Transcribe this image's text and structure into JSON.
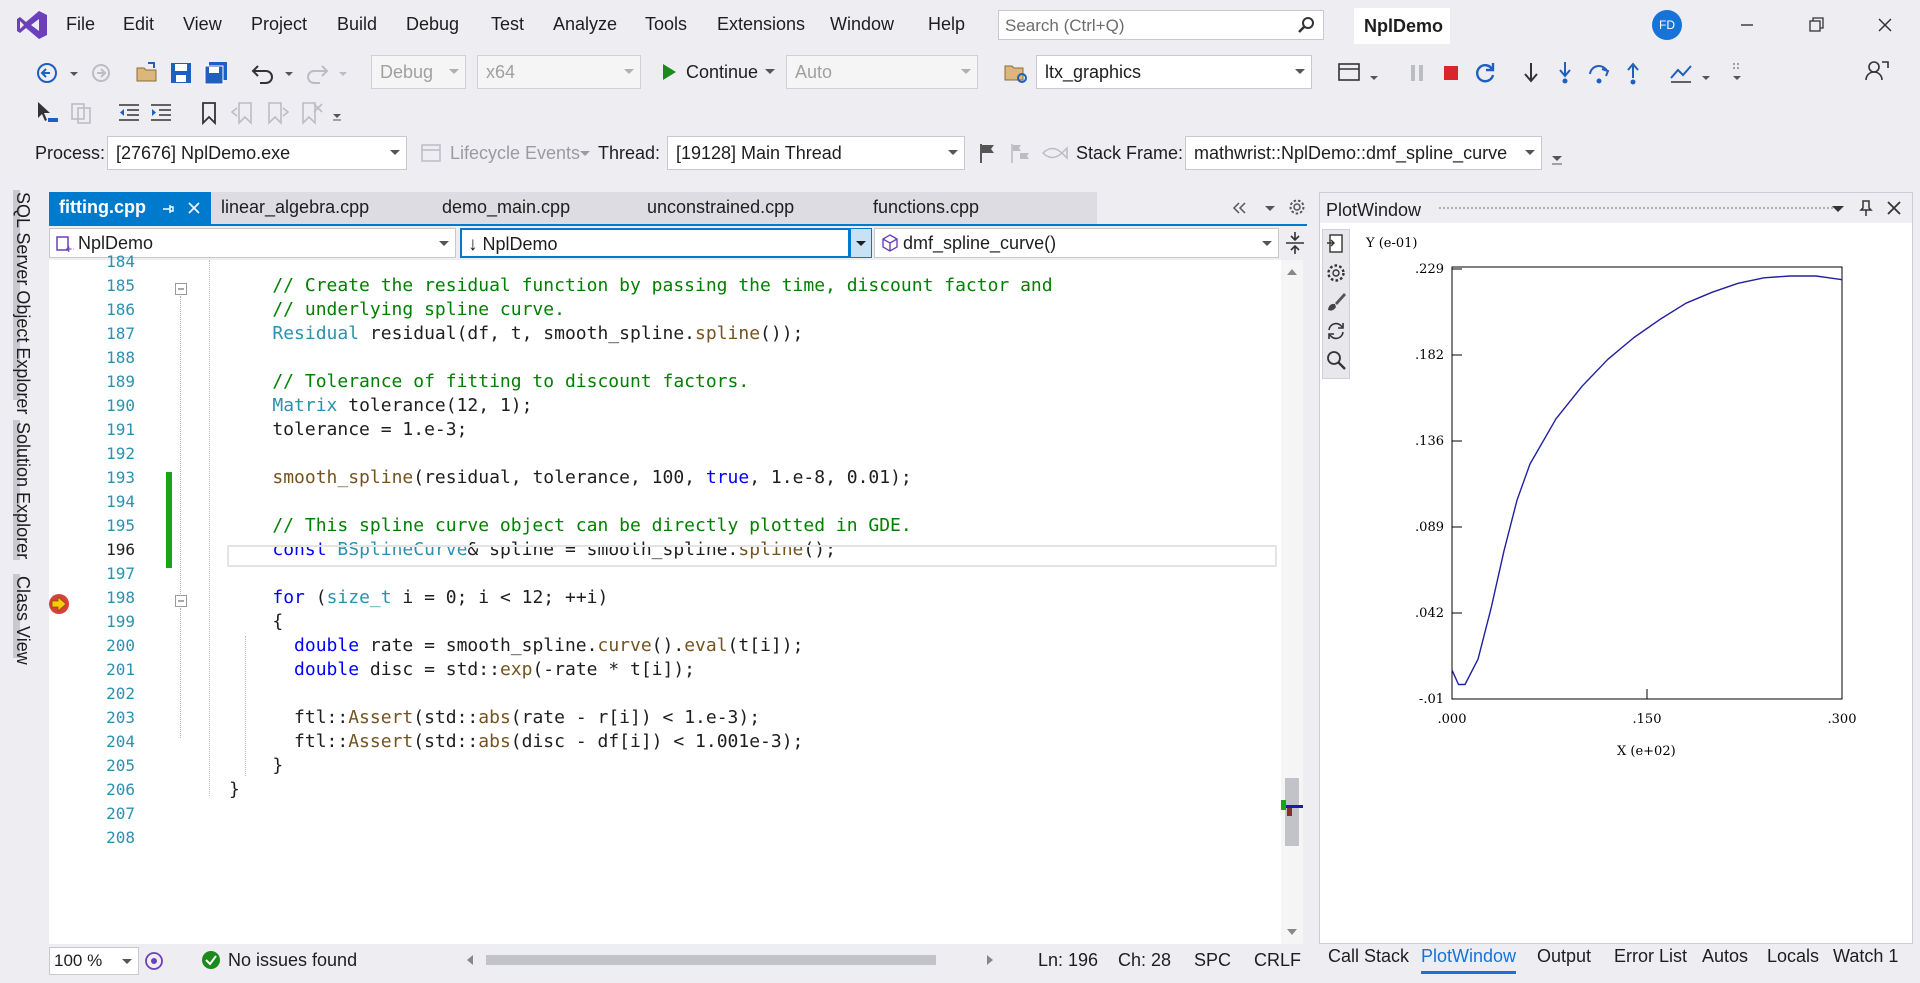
{
  "menu": [
    "File",
    "Edit",
    "View",
    "Project",
    "Build",
    "Debug",
    "Test",
    "Analyze",
    "Tools",
    "Extensions",
    "Window",
    "Help"
  ],
  "search": {
    "placeholder": "Search (Ctrl+Q)"
  },
  "solution_title": "NplDemo",
  "user_initials": "FD",
  "toolbar1": {
    "config": "Debug",
    "platform": "x64",
    "continue_label": "Continue",
    "auto": "Auto",
    "project": "ltx_graphics"
  },
  "debug_location": {
    "process_label": "Process:",
    "process": "[27676] NplDemo.exe",
    "lifecycle_label": "Lifecycle Events",
    "thread_label": "Thread:",
    "thread": "[19128] Main Thread",
    "stack_label": "Stack Frame:",
    "stack_frame": "mathwrist::NplDemo::dmf_spline_curve"
  },
  "side_tabs": [
    "SQL Server Object Explorer",
    "Solution Explorer",
    "Class View"
  ],
  "doc_tabs": [
    "fitting.cpp",
    "linear_algebra.cpp",
    "demo_main.cpp",
    "unconstrained.cpp",
    "functions.cpp"
  ],
  "nav": {
    "project": "NplDemo",
    "scope": "NplDemo",
    "member": "dmf_spline_curve()"
  },
  "editor": {
    "current_line": "196",
    "lines": [
      {
        "n": "184",
        "segs": []
      },
      {
        "n": "185",
        "segs": [
          {
            "t": "    // Create the residual function by passing the time, discount factor and",
            "c": "cm"
          }
        ]
      },
      {
        "n": "186",
        "segs": [
          {
            "t": "    // underlying spline curve.",
            "c": "cm"
          }
        ]
      },
      {
        "n": "187",
        "segs": [
          {
            "t": "    ",
            "c": "tx"
          },
          {
            "t": "Residual",
            "c": "ty"
          },
          {
            "t": " residual(df, t, smooth_spline.",
            "c": "tx"
          },
          {
            "t": "spline",
            "c": "fn"
          },
          {
            "t": "());",
            "c": "tx"
          }
        ]
      },
      {
        "n": "188",
        "segs": []
      },
      {
        "n": "189",
        "segs": [
          {
            "t": "    // Tolerance of fitting to discount factors.",
            "c": "cm"
          }
        ]
      },
      {
        "n": "190",
        "segs": [
          {
            "t": "    ",
            "c": "tx"
          },
          {
            "t": "Matrix",
            "c": "ty"
          },
          {
            "t": " tolerance(12, 1);",
            "c": "tx"
          }
        ]
      },
      {
        "n": "191",
        "segs": [
          {
            "t": "    tolerance = 1.e-3;",
            "c": "tx"
          }
        ]
      },
      {
        "n": "192",
        "segs": []
      },
      {
        "n": "193",
        "segs": [
          {
            "t": "    ",
            "c": "tx"
          },
          {
            "t": "smooth_spline",
            "c": "fn"
          },
          {
            "t": "(residual, tolerance, 100, ",
            "c": "tx"
          },
          {
            "t": "true",
            "c": "kw"
          },
          {
            "t": ", 1.e-8, 0.01);",
            "c": "tx"
          }
        ]
      },
      {
        "n": "194",
        "segs": []
      },
      {
        "n": "195",
        "segs": [
          {
            "t": "    // This spline curve object can be directly plotted in GDE.",
            "c": "cm"
          }
        ]
      },
      {
        "n": "196",
        "segs": [
          {
            "t": "    ",
            "c": "tx"
          },
          {
            "t": "const",
            "c": "kw"
          },
          {
            "t": " ",
            "c": "tx"
          },
          {
            "t": "BSplineCurve",
            "c": "ty"
          },
          {
            "t": "& spline = smooth_spline.",
            "c": "tx"
          },
          {
            "t": "spline",
            "c": "fn"
          },
          {
            "t": "();",
            "c": "tx"
          }
        ]
      },
      {
        "n": "197",
        "segs": []
      },
      {
        "n": "198",
        "segs": [
          {
            "t": "    ",
            "c": "tx"
          },
          {
            "t": "for",
            "c": "kw"
          },
          {
            "t": " (",
            "c": "tx"
          },
          {
            "t": "size_t",
            "c": "ty"
          },
          {
            "t": " i = 0; i < 12; ++i)",
            "c": "tx"
          }
        ]
      },
      {
        "n": "199",
        "segs": [
          {
            "t": "    {",
            "c": "tx"
          }
        ]
      },
      {
        "n": "200",
        "segs": [
          {
            "t": "      ",
            "c": "tx"
          },
          {
            "t": "double",
            "c": "kw"
          },
          {
            "t": " rate = smooth_spline.",
            "c": "tx"
          },
          {
            "t": "curve",
            "c": "fn"
          },
          {
            "t": "().",
            "c": "tx"
          },
          {
            "t": "eval",
            "c": "fn"
          },
          {
            "t": "(t[i]);",
            "c": "tx"
          }
        ]
      },
      {
        "n": "201",
        "segs": [
          {
            "t": "      ",
            "c": "tx"
          },
          {
            "t": "double",
            "c": "kw"
          },
          {
            "t": " disc = std::",
            "c": "tx"
          },
          {
            "t": "exp",
            "c": "fn"
          },
          {
            "t": "(-rate * t[i]);",
            "c": "tx"
          }
        ]
      },
      {
        "n": "202",
        "segs": []
      },
      {
        "n": "203",
        "segs": [
          {
            "t": "      ftl::",
            "c": "tx"
          },
          {
            "t": "Assert",
            "c": "fn"
          },
          {
            "t": "(std::",
            "c": "tx"
          },
          {
            "t": "abs",
            "c": "fn"
          },
          {
            "t": "(rate - r[i]) < 1.e-3);",
            "c": "tx"
          }
        ]
      },
      {
        "n": "204",
        "segs": [
          {
            "t": "      ftl::",
            "c": "tx"
          },
          {
            "t": "Assert",
            "c": "fn"
          },
          {
            "t": "(std::",
            "c": "tx"
          },
          {
            "t": "abs",
            "c": "fn"
          },
          {
            "t": "(disc - df[i]) < 1.001e-3);",
            "c": "tx"
          }
        ]
      },
      {
        "n": "205",
        "segs": [
          {
            "t": "    }",
            "c": "tx"
          }
        ]
      },
      {
        "n": "206",
        "segs": [
          {
            "t": "}",
            "c": "tx"
          }
        ]
      },
      {
        "n": "207",
        "segs": []
      },
      {
        "n": "208",
        "segs": []
      }
    ]
  },
  "status": {
    "zoom": "100 %",
    "issues": "No issues found",
    "ln": "Ln: 196",
    "ch": "Ch: 28",
    "spc": "SPC",
    "crlf": "CRLF"
  },
  "plot_window": {
    "title": "PlotWindow",
    "chart_data": {
      "type": "line",
      "title": "",
      "ylabel": "Y (e-01)",
      "xlabel": "X (e+02)",
      "y_ticks": [
        ".229",
        ".182",
        ".136",
        ".089",
        ".042",
        "-.01"
      ],
      "x_ticks": [
        ".000",
        ".150",
        ".300"
      ],
      "xlim": [
        0.0,
        0.3
      ],
      "ylim": [
        -0.01,
        0.229
      ],
      "series": [
        {
          "x": [
            0.0,
            0.005,
            0.01,
            0.02,
            0.03,
            0.04,
            0.05,
            0.06,
            0.08,
            0.1,
            0.12,
            0.14,
            0.16,
            0.18,
            0.2,
            0.22,
            0.24,
            0.26,
            0.27,
            0.28,
            0.29,
            0.3
          ],
          "y": [
            0.006,
            -0.002,
            -0.002,
            0.012,
            0.04,
            0.072,
            0.1,
            0.12,
            0.145,
            0.163,
            0.178,
            0.19,
            0.2,
            0.209,
            0.215,
            0.22,
            0.223,
            0.224,
            0.224,
            0.224,
            0.223,
            0.222
          ],
          "color": "#2020a0"
        }
      ]
    }
  },
  "bottom_tabs": [
    "Call Stack",
    "PlotWindow",
    "Output",
    "Error List",
    "Autos",
    "Locals",
    "Watch 1"
  ]
}
